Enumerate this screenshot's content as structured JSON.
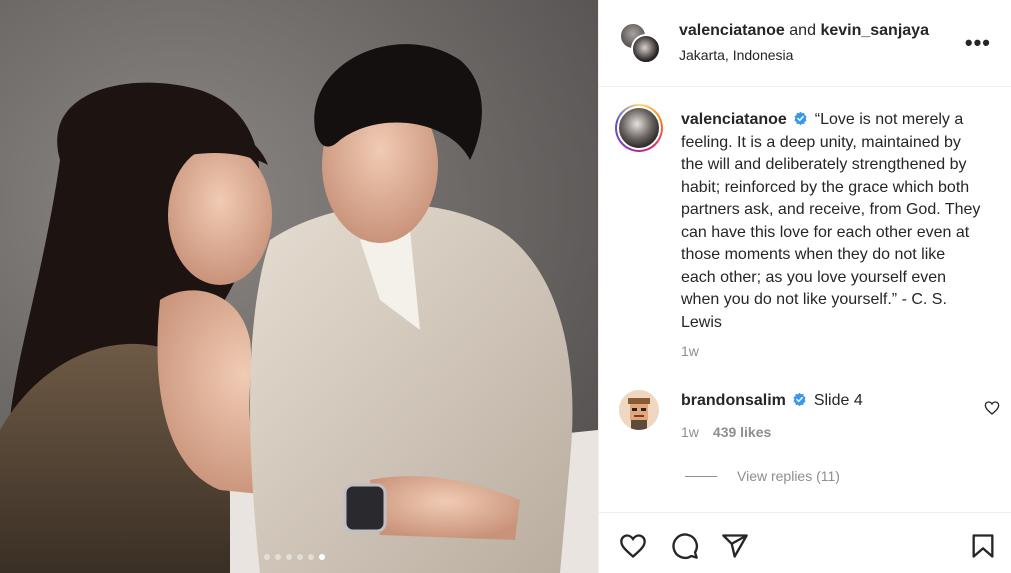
{
  "post": {
    "photo_alt": "Couple portrait, slide 6",
    "carousel": {
      "total": 6,
      "active": 6
    }
  },
  "header": {
    "user1": "valenciatanoe",
    "joiner": "and",
    "user2": "kevin_sanjaya",
    "location": "Jakarta, Indonesia",
    "more_label": "•••"
  },
  "caption": {
    "username": "valenciatanoe",
    "text": "“Love is not merely a feeling. It is a deep unity, maintained by the will and deliberately strengthened by habit; reinforced by the grace which both partners ask, and receive, from God. They can have this love for each other even at those moments when they do not like each other; as you love yourself even when you do not like yourself.” - C. S. Lewis",
    "time": "1w"
  },
  "comment": {
    "username": "brandonsalim",
    "text": "Slide 4",
    "time": "1w",
    "likes": "439 likes",
    "view_replies": "View replies (11)"
  },
  "colors": {
    "verified": "#3897f0",
    "text": "#262626",
    "muted": "#8e8e8e",
    "border": "#efefef"
  },
  "icons": [
    "heart-icon",
    "comment-icon",
    "share-icon",
    "bookmark-icon",
    "more-icon",
    "verified-badge-icon"
  ]
}
